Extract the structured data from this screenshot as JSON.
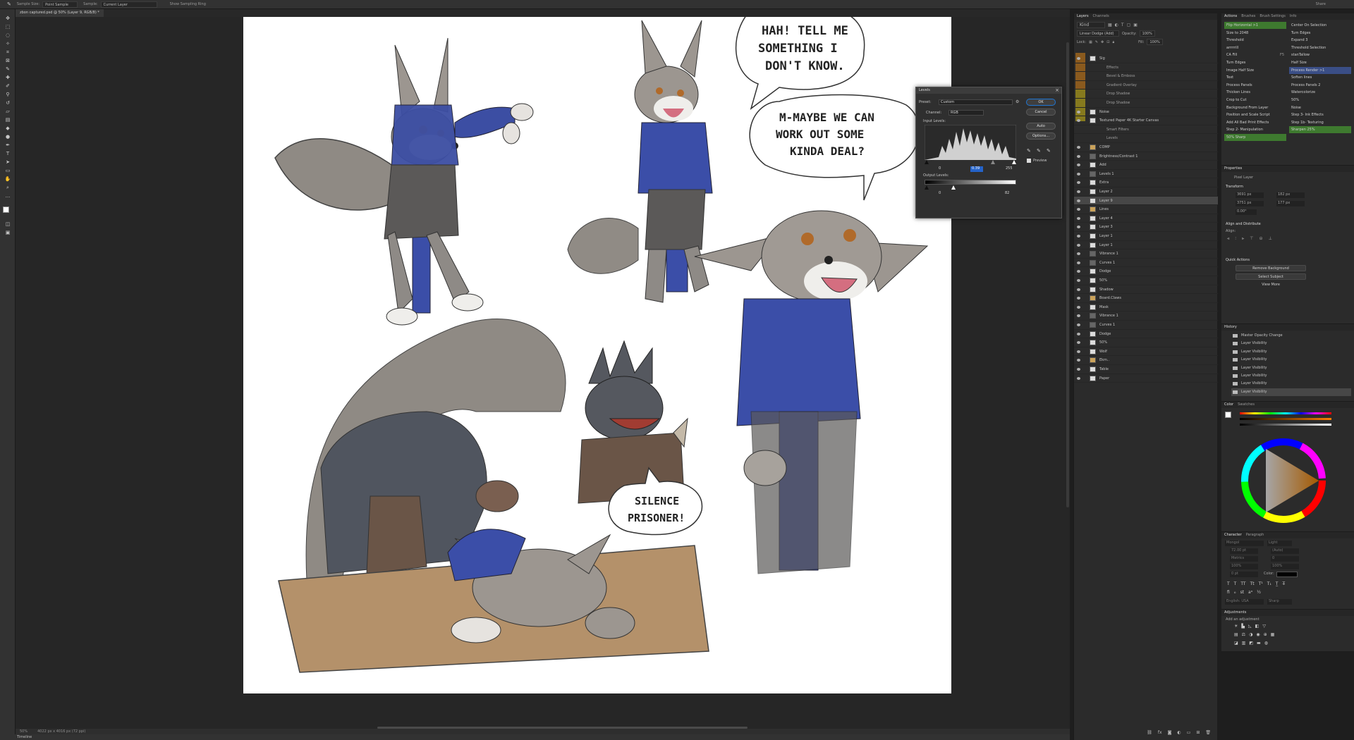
{
  "option_bar": {
    "sample_size_label": "Sample Size:",
    "sample_size_value": "Point Sample",
    "sample_label": "Sample:",
    "sample_value": "Current Layer",
    "show_ring": "Show Sampling Ring",
    "share": "Share"
  },
  "document_tab": "zbon captured.psd @ 50% (Layer 9, RGB/8) *",
  "speech": {
    "bubble1": [
      "HAH! TELL ME",
      "SOMETHING I",
      "DON'T KNOW."
    ],
    "bubble2": [
      "M-MAYBE WE CAN",
      "WORK OUT SOME",
      "KINDA DEAL?"
    ],
    "bubble3": [
      "SILENCE",
      "PRISONER!"
    ]
  },
  "status": {
    "zoom": "50%",
    "doc_size": "4022 px x 4016 px (72 ppi)"
  },
  "timeline_label": "Timeline",
  "layers_panel": {
    "tabs": [
      "Layers",
      "Channels"
    ],
    "search_placeholder": "Kind",
    "blend_mode": "Linear Dodge (Add)",
    "opacity_label": "Opacity:",
    "opacity_value": "100%",
    "lock_label": "Lock:",
    "fill_label": "Fill:",
    "fill_value": "100%",
    "rows": [
      {
        "name": "Sig",
        "kind": "layer"
      },
      {
        "name": "Effects",
        "kind": "fx"
      },
      {
        "name": "Bevel & Emboss",
        "kind": "fx"
      },
      {
        "name": "Gradient Overlay",
        "kind": "fx"
      },
      {
        "name": "Drop Shadow",
        "kind": "fx"
      },
      {
        "name": "Drop Shadow",
        "kind": "fx"
      },
      {
        "name": "Noise",
        "kind": "layer"
      },
      {
        "name": "Textured Paper 4K Starter Canvas",
        "kind": "layer"
      },
      {
        "name": "Smart Filters",
        "kind": "fx"
      },
      {
        "name": "Levels",
        "kind": "fx"
      },
      {
        "name": "COMP",
        "kind": "group"
      },
      {
        "name": "Brightness/Contrast 1",
        "kind": "adj"
      },
      {
        "name": "Add",
        "kind": "layer"
      },
      {
        "name": "Levels 1",
        "kind": "adj"
      },
      {
        "name": "Extra",
        "kind": "layer"
      },
      {
        "name": "Layer 2",
        "kind": "layer"
      },
      {
        "name": "Layer 9",
        "kind": "selected"
      },
      {
        "name": "Lines",
        "kind": "group"
      },
      {
        "name": "Layer 4",
        "kind": "layer"
      },
      {
        "name": "Layer 3",
        "kind": "layer"
      },
      {
        "name": "Layer 1",
        "kind": "layer"
      },
      {
        "name": "Layer 1",
        "kind": "layer"
      },
      {
        "name": "Vibrance 1",
        "kind": "adj"
      },
      {
        "name": "Curves 1",
        "kind": "adj"
      },
      {
        "name": "Dodge",
        "kind": "layer"
      },
      {
        "name": "50%",
        "kind": "layer"
      },
      {
        "name": "Shadow",
        "kind": "layer"
      },
      {
        "name": "Board.Claws",
        "kind": "group"
      },
      {
        "name": "Mask",
        "kind": "layer"
      },
      {
        "name": "Vibrance 1",
        "kind": "adj"
      },
      {
        "name": "Curves 1",
        "kind": "adj"
      },
      {
        "name": "Dodge",
        "kind": "layer"
      },
      {
        "name": "50%",
        "kind": "layer"
      },
      {
        "name": "Wolf",
        "kind": "layer"
      },
      {
        "name": "Ekm..",
        "kind": "group"
      },
      {
        "name": "Table",
        "kind": "layer"
      },
      {
        "name": "Paper",
        "kind": "layer"
      }
    ]
  },
  "actions_panel": {
    "tabs": [
      "Actions",
      "Brushes",
      "Brush Settings",
      "Info"
    ],
    "left": [
      "Flip Horizontal >1",
      "Size to 2048",
      "Threshold",
      "arrrrrill",
      "CA Fill",
      "Turn Edges",
      "Image Half Size",
      "Text",
      "Process Panels",
      "Thicken Lines",
      "Crop to Cut",
      "Background From Layer",
      "Position and Scale Script",
      "Add All Bad Print Effects",
      "Step 2- Manipulation",
      "50% Sharp"
    ],
    "left_keys": [
      "",
      "",
      "",
      "",
      "F5",
      "",
      "",
      "",
      "",
      "",
      "",
      "",
      "",
      "",
      "",
      ""
    ],
    "right": [
      "Center On Selection",
      "Turn Edges",
      "Expand 3",
      "Threshold Selection",
      "stanTallow",
      "Half Size",
      "Process Render >1",
      "Soften lines",
      "Process Panels 2",
      "Watercolorize",
      "50%",
      "Noise",
      "Step 3- Ink Effects",
      "Step 1b- Texturing",
      "Sharpen 25%",
      ""
    ]
  },
  "properties_panel": {
    "title": "Properties",
    "kind": "Pixel Layer",
    "transform_label": "Transform",
    "w": "3691 px",
    "h": "3751 px",
    "x": "182 px",
    "y": "177 px",
    "angle": "0.00°",
    "align_label": "Align and Distribute",
    "align_sub": "Align:",
    "quick_actions_label": "Quick Actions",
    "remove_bg": "Remove Background",
    "select_subject": "Select Subject",
    "view_more": "View More"
  },
  "history_panel": {
    "title": "History",
    "rows": [
      "Master Opacity Change",
      "Layer Visibility",
      "Layer Visibility",
      "Layer Visibility",
      "Layer Visibility",
      "Layer Visibility",
      "Layer Visibility",
      "Layer Visibility"
    ]
  },
  "color_panel": {
    "tabs": [
      "Color",
      "Swatches"
    ],
    "fg": "#ffffff",
    "bg": "#000000"
  },
  "character_panel": {
    "tabs": [
      "Character",
      "Paragraph"
    ],
    "font": "Mongol",
    "style": "Light",
    "size": "72.00 pt",
    "leading": "(Auto)",
    "tracking": "Metrics",
    "kerning": "0",
    "scale_v": "100%",
    "scale_h": "100%",
    "baseline": "0 pt",
    "color_label": "Color:",
    "language": "English: USA",
    "aa": "Sharp"
  },
  "adjustments_panel": {
    "title": "Adjustments",
    "add_label": "Add an adjustment"
  },
  "levels_dialog": {
    "title": "Levels",
    "preset_label": "Preset:",
    "preset_value": "Custom",
    "channel_label": "Channel:",
    "channel_value": "RGB",
    "input_label": "Input Levels:",
    "input_black": "0",
    "input_mid": "0.39",
    "input_white": "255",
    "output_label": "Output Levels:",
    "output_black": "0",
    "output_white": "82",
    "ok": "OK",
    "cancel": "Cancel",
    "auto": "Auto",
    "options": "Options...",
    "preview": "Preview"
  }
}
